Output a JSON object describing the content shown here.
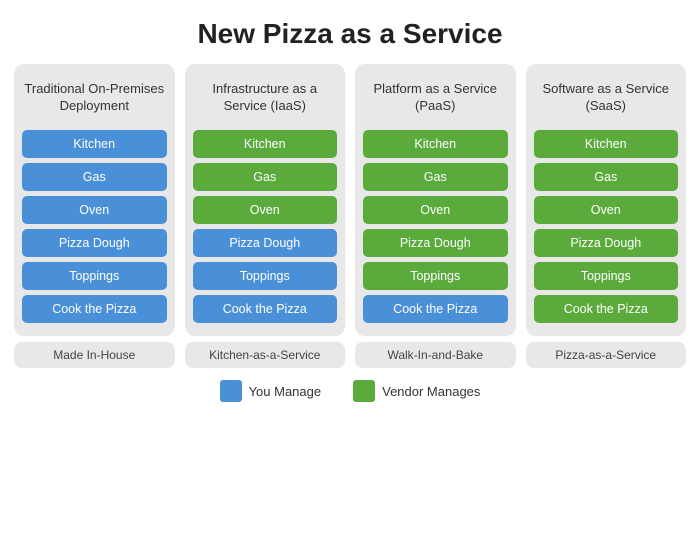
{
  "title": "New Pizza as a Service",
  "columns": [
    {
      "id": "traditional",
      "title": "Traditional\nOn-Premises\nDeployment",
      "items": [
        {
          "label": "Kitchen",
          "type": "blue"
        },
        {
          "label": "Gas",
          "type": "blue"
        },
        {
          "label": "Oven",
          "type": "blue"
        },
        {
          "label": "Pizza Dough",
          "type": "blue"
        },
        {
          "label": "Toppings",
          "type": "blue"
        },
        {
          "label": "Cook the Pizza",
          "type": "blue"
        }
      ],
      "footer": "Made In-House"
    },
    {
      "id": "iaas",
      "title": "Infrastructure\nas a Service\n(IaaS)",
      "items": [
        {
          "label": "Kitchen",
          "type": "green"
        },
        {
          "label": "Gas",
          "type": "green"
        },
        {
          "label": "Oven",
          "type": "green"
        },
        {
          "label": "Pizza Dough",
          "type": "blue"
        },
        {
          "label": "Toppings",
          "type": "blue"
        },
        {
          "label": "Cook the Pizza",
          "type": "blue"
        }
      ],
      "footer": "Kitchen-as-a-Service"
    },
    {
      "id": "paas",
      "title": "Platform\nas a Service\n(PaaS)",
      "items": [
        {
          "label": "Kitchen",
          "type": "green"
        },
        {
          "label": "Gas",
          "type": "green"
        },
        {
          "label": "Oven",
          "type": "green"
        },
        {
          "label": "Pizza Dough",
          "type": "green"
        },
        {
          "label": "Toppings",
          "type": "green"
        },
        {
          "label": "Cook the Pizza",
          "type": "blue"
        }
      ],
      "footer": "Walk-In-and-Bake"
    },
    {
      "id": "saas",
      "title": "Software\nas a Service\n(SaaS)",
      "items": [
        {
          "label": "Kitchen",
          "type": "green"
        },
        {
          "label": "Gas",
          "type": "green"
        },
        {
          "label": "Oven",
          "type": "green"
        },
        {
          "label": "Pizza Dough",
          "type": "green"
        },
        {
          "label": "Toppings",
          "type": "green"
        },
        {
          "label": "Cook the Pizza",
          "type": "green"
        }
      ],
      "footer": "Pizza-as-a-Service"
    }
  ],
  "legend": {
    "you_manage_label": "You Manage",
    "vendor_manages_label": "Vendor Manages"
  }
}
